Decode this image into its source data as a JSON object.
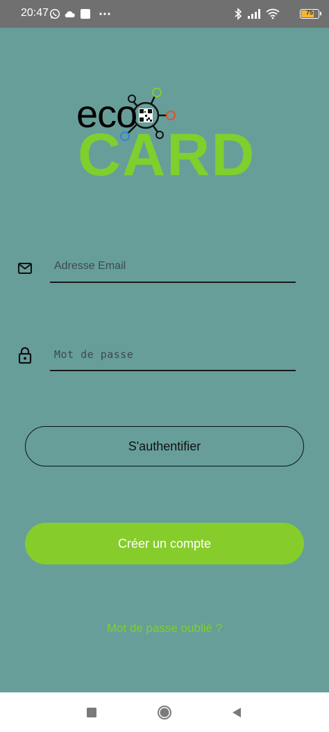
{
  "status_bar": {
    "time": "20:47",
    "battery_level": 75,
    "battery_label": "75",
    "icons_left": [
      "whatsapp-icon",
      "cloud-icon",
      "square-app-icon",
      "more-icon"
    ],
    "icons_right": [
      "bluetooth-icon",
      "signal-icon",
      "wifi-icon",
      "battery-icon"
    ]
  },
  "logo": {
    "word_top": "eco",
    "word_bottom": "CARD",
    "colors": {
      "eco": "#000000",
      "card": "#7fcf2d",
      "node_green": "#7fcf2d",
      "node_red": "#e2502b",
      "node_blue": "#2f86d6"
    }
  },
  "form": {
    "email": {
      "placeholder": "Adresse Email",
      "value": "",
      "icon": "mail-icon"
    },
    "password": {
      "placeholder": "Mot de passe",
      "value": "",
      "icon": "lock-icon"
    }
  },
  "buttons": {
    "login_label": "S'authentifier",
    "register_label": "Créer un compte"
  },
  "links": {
    "forgot_password": "Mot de passe oublié ?"
  },
  "colors": {
    "background": "#679e9a",
    "accent": "#86cd2c",
    "status_bar": "#707070",
    "nav_bar": "#ffffff"
  },
  "nav_bar": {
    "buttons": [
      "recent-apps-icon",
      "home-icon",
      "back-icon"
    ]
  }
}
